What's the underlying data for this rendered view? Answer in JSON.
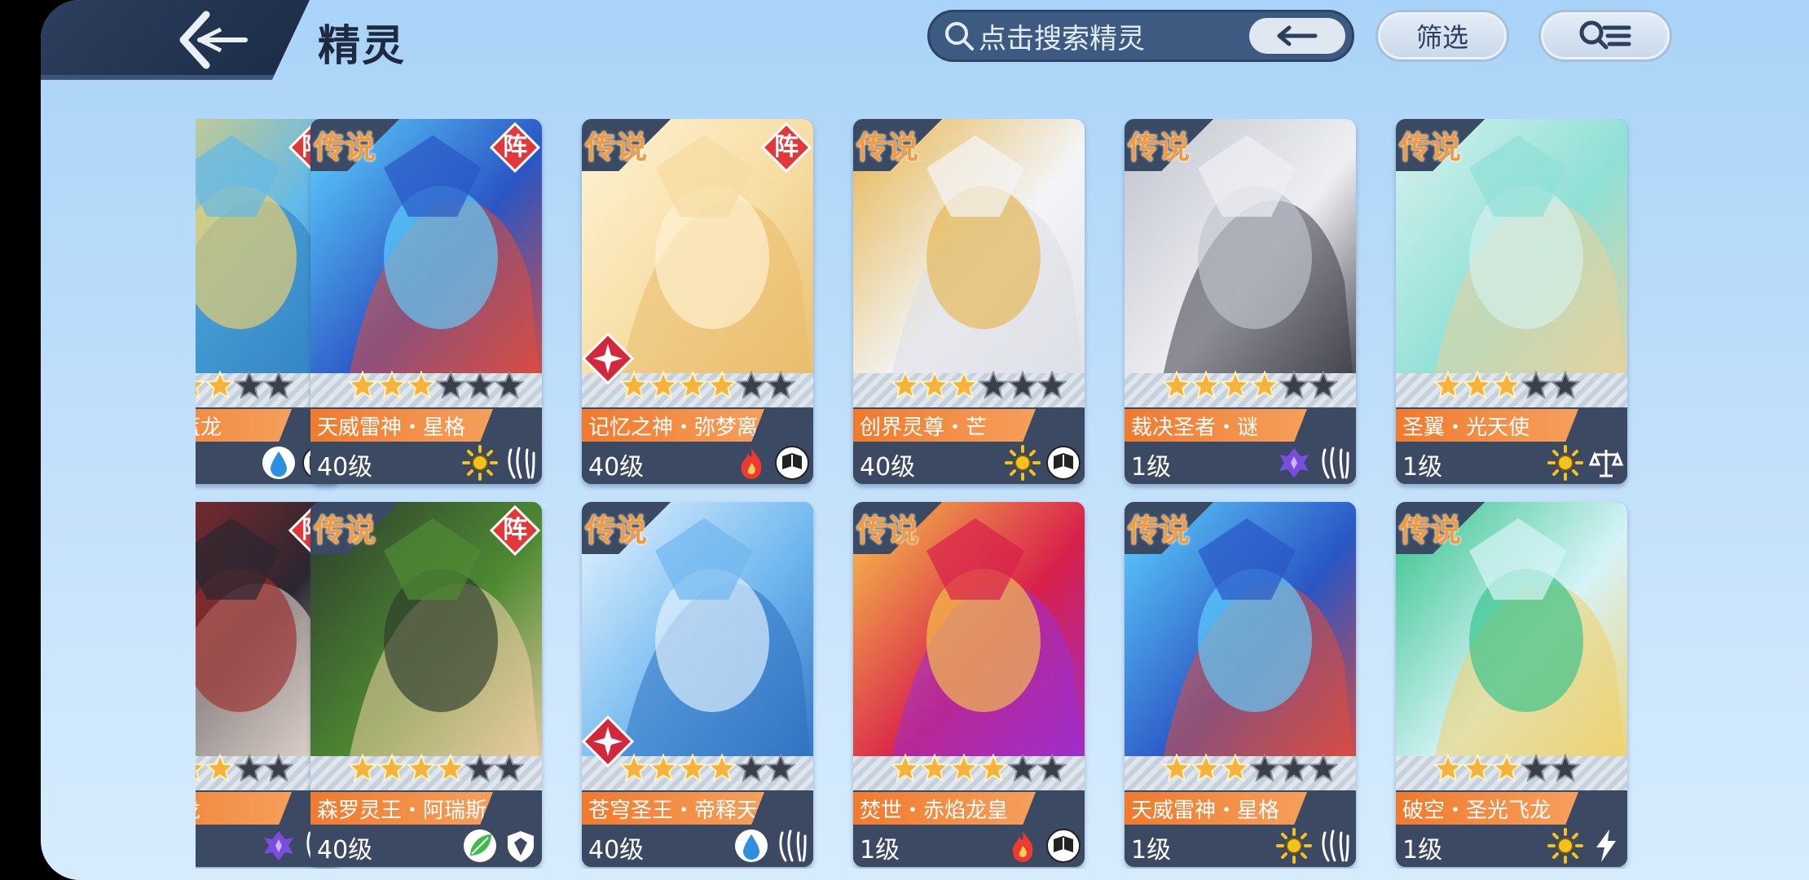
{
  "header": {
    "title": "精灵",
    "search_placeholder": "点击搜索精灵",
    "filter_label": "筛选"
  },
  "colors": {
    "accent": "#f07a2e",
    "header_dark": "#2c3f5e",
    "background": "#b8dbfa"
  },
  "cards": [
    {
      "rank": "",
      "formation": "阵",
      "name": "说・星蓝龙",
      "level": "",
      "stars_filled": 3,
      "stars_total": 5,
      "icon1": "water-icon",
      "icon2": "book-icon",
      "art": [
        "#63b9e8",
        "#2e7fbf",
        "#f1d36b"
      ],
      "badge": false
    },
    {
      "rank": "传说",
      "formation": "阵",
      "name": "天威雷神・星格",
      "level": "40级",
      "stars_filled": 3,
      "stars_total": 6,
      "icon1": "light-icon",
      "icon2": "claw-icon",
      "art": [
        "#2a56c4",
        "#e24c3a",
        "#5fd2ff"
      ],
      "badge": false
    },
    {
      "rank": "传说",
      "formation": "阵",
      "name": "记忆之神・弥梦离",
      "level": "40级",
      "stars_filled": 4,
      "stars_total": 6,
      "icon1": "fire-icon",
      "icon2": "book-icon",
      "art": [
        "#f6dca1",
        "#e9bb6c",
        "#fff3d5"
      ],
      "badge": true
    },
    {
      "rank": "传说",
      "formation": "",
      "name": "创界灵尊・芒",
      "level": "40级",
      "stars_filled": 3,
      "stars_total": 6,
      "icon1": "light-icon",
      "icon2": "book-icon",
      "art": [
        "#f3f5f8",
        "#dcdfe6",
        "#e7b64f"
      ],
      "badge": false
    },
    {
      "rank": "传说",
      "formation": "",
      "name": "裁决圣者・谜",
      "level": "1级",
      "stars_filled": 4,
      "stars_total": 6,
      "icon1": "dark-icon",
      "icon2": "claw-icon",
      "art": [
        "#efeff3",
        "#3a3a46",
        "#c0c4ce"
      ],
      "badge": false
    },
    {
      "rank": "传说",
      "formation": "",
      "name": "圣翼・光天使",
      "level": "1级",
      "stars_filled": 3,
      "stars_total": 5,
      "icon1": "light-icon",
      "icon2": "scale-icon",
      "art": [
        "#8fe0d6",
        "#e9d29c",
        "#d6f1ee"
      ],
      "badge": false
    },
    {
      "rank": "",
      "formation": "阵",
      "name": "时空圣龙",
      "level": "",
      "stars_filled": 3,
      "stars_total": 5,
      "icon1": "dark-icon",
      "icon2": "claw-icon",
      "art": [
        "#2a2630",
        "#f2e6dc",
        "#9b2b2b"
      ],
      "badge": false
    },
    {
      "rank": "传说",
      "formation": "阵",
      "name": "森罗灵王・阿瑞斯",
      "level": "40级",
      "stars_filled": 4,
      "stars_total": 6,
      "icon1": "grass-icon",
      "icon2": "shield-icon",
      "art": [
        "#4f8b33",
        "#f3cfa8",
        "#2d3b2c"
      ],
      "badge": false
    },
    {
      "rank": "传说",
      "formation": "",
      "name": "苍穹圣王・帝释天",
      "level": "40级",
      "stars_filled": 4,
      "stars_total": 6,
      "icon1": "water-icon",
      "icon2": "claw-icon",
      "art": [
        "#6fb7ef",
        "#2d6fc0",
        "#e6f4ff"
      ],
      "badge": true
    },
    {
      "rank": "传说",
      "formation": "",
      "name": "焚世・赤焰龙皇",
      "level": "1级",
      "stars_filled": 4,
      "stars_total": 6,
      "icon1": "fire-icon",
      "icon2": "book-icon",
      "art": [
        "#d8204a",
        "#9b2fd6",
        "#f7c64a"
      ],
      "badge": false
    },
    {
      "rank": "传说",
      "formation": "",
      "name": "天威雷神・星格",
      "level": "1级",
      "stars_filled": 3,
      "stars_total": 6,
      "icon1": "light-icon",
      "icon2": "claw-icon",
      "art": [
        "#2a56c4",
        "#e24c3a",
        "#5fd2ff"
      ],
      "badge": false
    },
    {
      "rank": "传说",
      "formation": "",
      "name": "破空・圣光飞龙",
      "level": "1级",
      "stars_filled": 3,
      "stars_total": 5,
      "icon1": "light-icon",
      "icon2": "bolt-icon",
      "art": [
        "#d6f3f7",
        "#f0cf6a",
        "#33c38a"
      ],
      "badge": false
    }
  ]
}
